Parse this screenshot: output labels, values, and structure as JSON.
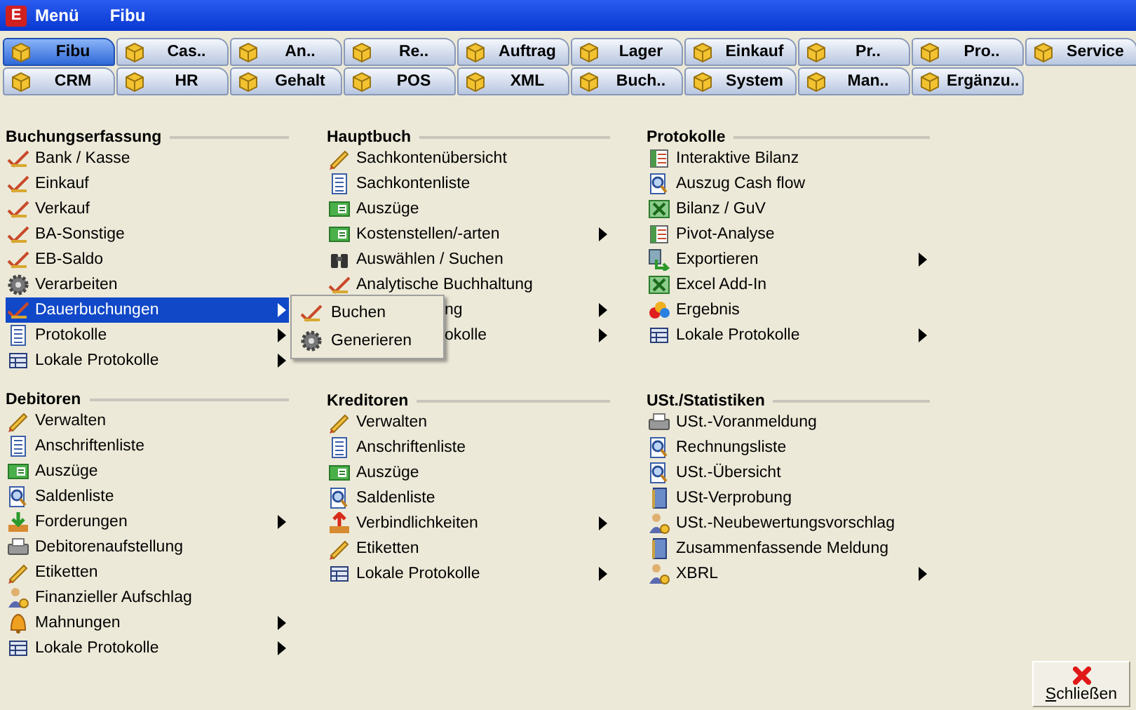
{
  "menubar": {
    "logo": "E",
    "items": [
      "Menü",
      "Fibu"
    ]
  },
  "tabs": [
    {
      "label": "Fibu",
      "selected": true
    },
    {
      "label": "Cas..",
      "selected": false
    },
    {
      "label": "An..",
      "selected": false
    },
    {
      "label": "Re..",
      "selected": false
    },
    {
      "label": "Auftrag",
      "selected": false
    },
    {
      "label": "Lager",
      "selected": false
    },
    {
      "label": "Einkauf",
      "selected": false
    },
    {
      "label": "Pr..",
      "selected": false
    },
    {
      "label": "Pro..",
      "selected": false
    },
    {
      "label": "Service",
      "selected": false
    },
    {
      "label": "CRM",
      "selected": false
    },
    {
      "label": "HR",
      "selected": false
    },
    {
      "label": "Gehalt",
      "selected": false
    },
    {
      "label": "POS",
      "selected": false
    },
    {
      "label": "XML",
      "selected": false
    },
    {
      "label": "Buch..",
      "selected": false
    },
    {
      "label": "System",
      "selected": false
    },
    {
      "label": "Man..",
      "selected": false
    },
    {
      "label": "Ergänzu..",
      "selected": false
    }
  ],
  "sections": [
    {
      "title": "Buchungserfassung",
      "items": [
        {
          "label": "Bank / Kasse",
          "kind": "booking",
          "submenu": false,
          "selected": false
        },
        {
          "label": "Einkauf",
          "kind": "booking",
          "submenu": false,
          "selected": false
        },
        {
          "label": "Verkauf",
          "kind": "booking",
          "submenu": false,
          "selected": false
        },
        {
          "label": "BA-Sonstige",
          "kind": "booking",
          "submenu": false,
          "selected": false
        },
        {
          "label": "EB-Saldo",
          "kind": "booking",
          "submenu": false,
          "selected": false
        },
        {
          "label": "Verarbeiten",
          "kind": "gear",
          "submenu": false,
          "selected": false
        },
        {
          "label": "Dauerbuchungen",
          "kind": "booking",
          "submenu": true,
          "selected": true,
          "popup": [
            {
              "label": "Buchen",
              "kind": "booking"
            },
            {
              "label": "Generieren",
              "kind": "gear"
            }
          ]
        },
        {
          "label": "Protokolle",
          "kind": "list",
          "submenu": true,
          "selected": false
        },
        {
          "label": "Lokale Protokolle",
          "kind": "table",
          "submenu": true,
          "selected": false
        }
      ]
    },
    {
      "title": "Hauptbuch",
      "items": [
        {
          "label": "Sachkontenübersicht",
          "kind": "pencil",
          "submenu": false,
          "selected": false
        },
        {
          "label": "Sachkontenliste",
          "kind": "list",
          "submenu": false,
          "selected": false
        },
        {
          "label": "Auszüge",
          "kind": "card",
          "submenu": false,
          "selected": false
        },
        {
          "label": "Kostenstellen/-arten",
          "kind": "card",
          "submenu": true,
          "selected": false
        },
        {
          "label": "Auswählen / Suchen",
          "kind": "binoculars",
          "submenu": false,
          "selected": false
        },
        {
          "label": "Analytische Buchhaltung",
          "kind": "booking",
          "submenu": false,
          "selected": false
        },
        {
          "label": "ng",
          "kind": "covered",
          "submenu": true,
          "selected": false
        },
        {
          "label": "okolle",
          "kind": "covered",
          "submenu": true,
          "selected": false
        }
      ]
    },
    {
      "title": "Protokolle",
      "items": [
        {
          "label": "Interaktive Bilanz",
          "kind": "sheet",
          "submenu": false,
          "selected": false
        },
        {
          "label": "Auszug Cash flow",
          "kind": "magnifier",
          "submenu": false,
          "selected": false
        },
        {
          "label": "Bilanz / GuV",
          "kind": "excel",
          "submenu": false,
          "selected": false
        },
        {
          "label": "Pivot-Analyse",
          "kind": "sheet",
          "submenu": false,
          "selected": false
        },
        {
          "label": "Exportieren",
          "kind": "export",
          "submenu": true,
          "selected": false
        },
        {
          "label": "Excel Add-In",
          "kind": "excel",
          "submenu": false,
          "selected": false
        },
        {
          "label": "Ergebnis",
          "kind": "blobs",
          "submenu": false,
          "selected": false
        },
        {
          "label": "Lokale Protokolle",
          "kind": "table",
          "submenu": true,
          "selected": false
        }
      ]
    },
    {
      "title": "Debitoren",
      "items": [
        {
          "label": "Verwalten",
          "kind": "pencil",
          "submenu": false,
          "selected": false
        },
        {
          "label": "Anschriftenliste",
          "kind": "list",
          "submenu": false,
          "selected": false
        },
        {
          "label": "Auszüge",
          "kind": "card",
          "submenu": false,
          "selected": false
        },
        {
          "label": "Saldenliste",
          "kind": "magnifier",
          "submenu": false,
          "selected": false
        },
        {
          "label": "Forderungen",
          "kind": "download",
          "submenu": true,
          "selected": false
        },
        {
          "label": "Debitorenaufstellung",
          "kind": "printer",
          "submenu": false,
          "selected": false
        },
        {
          "label": "Etiketten",
          "kind": "pencil",
          "submenu": false,
          "selected": false
        },
        {
          "label": "Finanzieller Aufschlag",
          "kind": "person",
          "submenu": false,
          "selected": false
        },
        {
          "label": "Mahnungen",
          "kind": "bell",
          "submenu": true,
          "selected": false
        },
        {
          "label": "Lokale Protokolle",
          "kind": "table",
          "submenu": true,
          "selected": false
        }
      ]
    },
    {
      "title": "Kreditoren",
      "items": [
        {
          "label": "Verwalten",
          "kind": "pencil",
          "submenu": false,
          "selected": false
        },
        {
          "label": "Anschriftenliste",
          "kind": "list",
          "submenu": false,
          "selected": false
        },
        {
          "label": "Auszüge",
          "kind": "card",
          "submenu": false,
          "selected": false
        },
        {
          "label": "Saldenliste",
          "kind": "magnifier",
          "submenu": false,
          "selected": false
        },
        {
          "label": "Verbindlichkeiten",
          "kind": "upload",
          "submenu": true,
          "selected": false
        },
        {
          "label": "Etiketten",
          "kind": "pencil",
          "submenu": false,
          "selected": false
        },
        {
          "label": "Lokale Protokolle",
          "kind": "table",
          "submenu": true,
          "selected": false
        }
      ]
    },
    {
      "title": "USt./Statistiken",
      "items": [
        {
          "label": "USt.-Voranmeldung",
          "kind": "printer",
          "submenu": false,
          "selected": false
        },
        {
          "label": "Rechnungsliste",
          "kind": "magnifier",
          "submenu": false,
          "selected": false
        },
        {
          "label": "USt.-Übersicht",
          "kind": "magnifier",
          "submenu": false,
          "selected": false
        },
        {
          "label": "USt-Verprobung",
          "kind": "book",
          "submenu": false,
          "selected": false
        },
        {
          "label": "USt.-Neubewertungsvorschlag",
          "kind": "person",
          "submenu": false,
          "selected": false
        },
        {
          "label": "Zusammenfassende Meldung",
          "kind": "book",
          "submenu": false,
          "selected": false
        },
        {
          "label": "XBRL",
          "kind": "person",
          "submenu": true,
          "selected": false
        }
      ]
    }
  ],
  "close_button": {
    "label": "Schließen",
    "access_key_underlined": true
  }
}
